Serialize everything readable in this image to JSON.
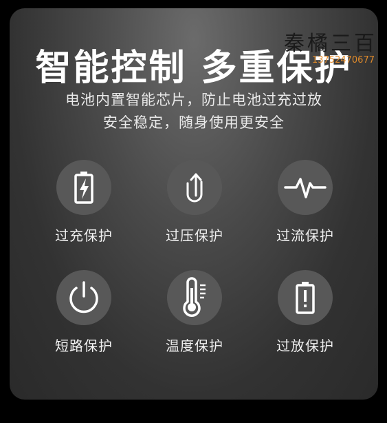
{
  "title": "智能控制 多重保护",
  "subtitle": {
    "line1": "电池内置智能芯片，防止电池过充过放",
    "line2": "安全稳定，随身使用更安全"
  },
  "features": [
    {
      "label": "过充保护",
      "icon": "battery-charge-icon"
    },
    {
      "label": "过压保护",
      "icon": "u-arrow-icon"
    },
    {
      "label": "过流保护",
      "icon": "pulse-icon"
    },
    {
      "label": "短路保护",
      "icon": "power-icon"
    },
    {
      "label": "温度保护",
      "icon": "thermometer-icon"
    },
    {
      "label": "过放保护",
      "icon": "battery-alert-icon"
    }
  ],
  "watermark": {
    "text": "秦橘三百",
    "sub": "13752470677"
  },
  "colors": {
    "background": "#000000",
    "card": "#4a4a4a",
    "icon_circle": "#585858",
    "text": "#ffffff",
    "watermark_orange": "#e08a2a"
  }
}
